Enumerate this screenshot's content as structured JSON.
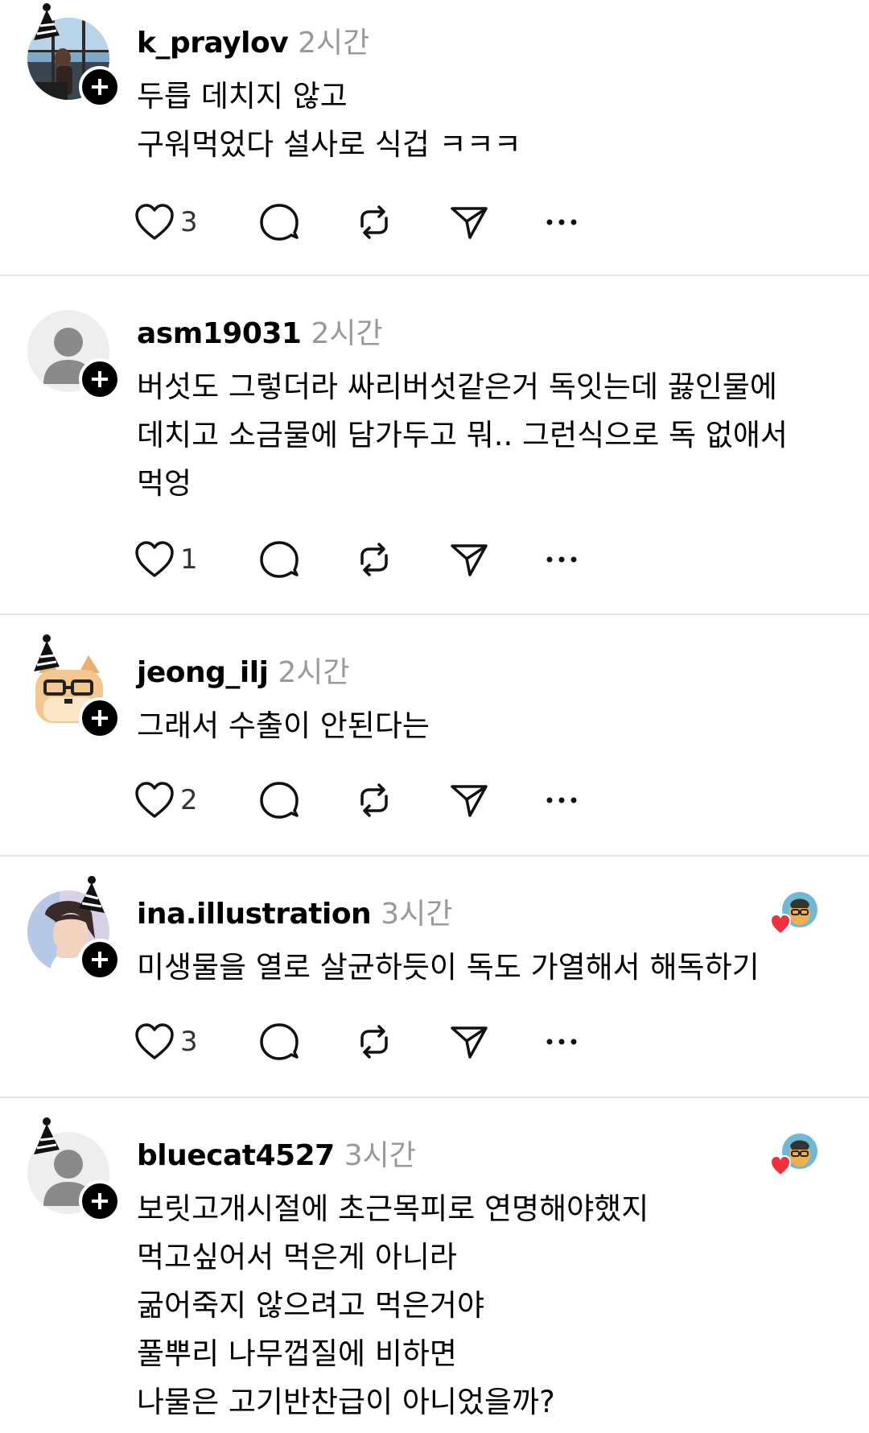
{
  "posts": [
    {
      "username": "k_praylov",
      "time": "2시간",
      "lines": [
        "두릅 데치지 않고",
        "구워먹었다 설사로 식겁 ㅋㅋㅋ"
      ],
      "likes": "3",
      "avatar": "photo-person-window",
      "has_party_hat": true,
      "liked_by_author": false
    },
    {
      "username": "asm19031",
      "time": "2시간",
      "lines": [
        "버섯도 그렇더라 싸리버섯같은거 독잇는데 끓인물에",
        "데치고 소금물에 담가두고 뭐.. 그런식으로 독 없애서",
        "먹엉"
      ],
      "likes": "1",
      "avatar": "default-user",
      "has_party_hat": false,
      "liked_by_author": false
    },
    {
      "username": "jeong_ilj",
      "time": "2시간",
      "lines": [
        "그래서 수출이 안된다는"
      ],
      "likes": "2",
      "avatar": "pixel-cat-glasses",
      "has_party_hat": true,
      "liked_by_author": false
    },
    {
      "username": "ina.illustration",
      "time": "3시간",
      "lines": [
        "미생물을 열로 살균하듯이 독도 가열해서 해독하기"
      ],
      "likes": "3",
      "avatar": "illustration-man",
      "has_party_hat": true,
      "liked_by_author": true
    },
    {
      "username": "bluecat4527",
      "time": "3시간",
      "lines": [
        "보릿고개시절에 초근목피로 연명해야했지",
        "먹고싶어서 먹은게 아니라",
        "굶어죽지 않으려고 먹은거야",
        "풀뿌리 나무껍질에 비하면",
        "나물은 고기반찬급이 아니었을까?"
      ],
      "likes": "",
      "avatar": "default-user",
      "has_party_hat": true,
      "liked_by_author": true
    }
  ],
  "icons": {
    "like": "heart-outline-icon",
    "reply": "comment-bubble-icon",
    "repost": "repost-icon",
    "share": "send-icon",
    "more": "more-dots-icon",
    "follow": "plus-icon",
    "author_liked": "author-liked-heart-icon"
  },
  "colors": {
    "text": "#000000",
    "muted": "#999999",
    "divider": "#e6e6e6",
    "like_red": "#f0303c"
  }
}
